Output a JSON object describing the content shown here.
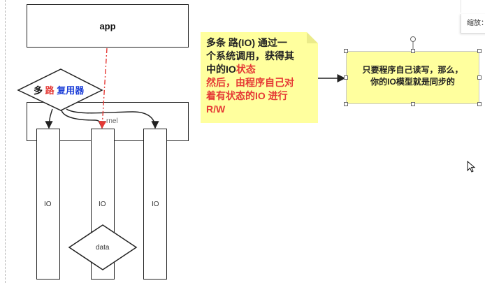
{
  "diagram": {
    "app_label": "app",
    "mux_label_parts": [
      "多",
      "路",
      "复用器"
    ],
    "kernel_label": "rnel",
    "io_labels": [
      "IO",
      "IO",
      "IO"
    ],
    "data_label": "data",
    "note_lines": [
      {
        "text": "多条 路(IO) 通过一",
        "red": ""
      },
      {
        "text": "个系统调用，获得其",
        "red": ""
      },
      {
        "text": "中的IO",
        "red": "状态"
      },
      {
        "text": "",
        "red": "然后，由程序自己对"
      },
      {
        "text": "",
        "red": "着有状态的IO 进行"
      },
      {
        "text": "",
        "red": "R/W"
      }
    ],
    "right_note_lines": [
      "只要程序自己读写，那么，",
      "你的IO模型就是同步的"
    ]
  },
  "zoom_panel": {
    "label": "缩放："
  },
  "colors": {
    "note_bg": "#ffff9e",
    "red": "#e53935",
    "blue": "#1e40d8",
    "stroke": "#222222"
  }
}
